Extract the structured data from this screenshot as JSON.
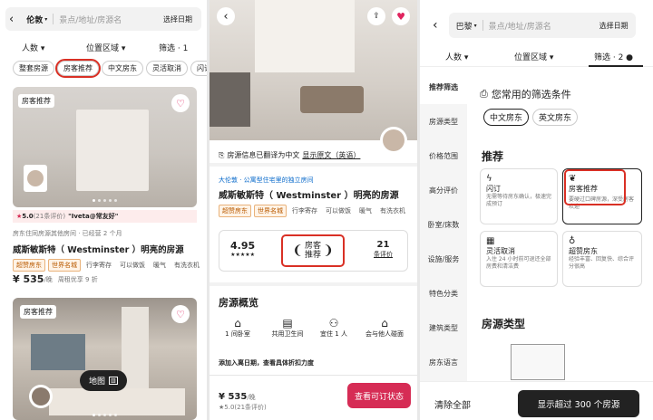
{
  "p1": {
    "city": "伦敦",
    "search_placeholder": "景点/地址/房源名",
    "date_btn": "选择日期",
    "filters": [
      {
        "label": "人数"
      },
      {
        "label": "位置区域"
      },
      {
        "label": "筛选 · 1"
      }
    ],
    "chips": [
      "整套房源",
      "房客推荐",
      "中文房东",
      "灵活取消",
      "闪订"
    ],
    "card1": {
      "badge": "房客推荐",
      "rating": "5.0",
      "rating_count": "(21条评价)",
      "quote": "\"Iveta@常友好\"",
      "host_line": "房东住同房源其他房间 · 已经营 2 个月",
      "title": "威斯敏斯特（ Westminster ）明亮的房源",
      "tags": [
        "超赞房东",
        "世界名城",
        "行李寄存",
        "可以做饭",
        "暖气",
        "有洗衣机"
      ],
      "price": "¥ 535",
      "price_unit": "/晚",
      "price_note": "周租优享 9 折"
    },
    "card2": {
      "badge": "房客推荐",
      "map_btn": "地图"
    }
  },
  "p2": {
    "translate_note": "房源信息已翻译为中文",
    "show_original": "显示原文（英语）",
    "location": "大伦敦 · 公寓型住宅里的独立房间",
    "title": "威斯敏斯特（ Westminster ）明亮的房源",
    "tags": [
      "超赞房东",
      "世界名城",
      "行李寄存",
      "可以做饭",
      "暖气",
      "有洗衣机"
    ],
    "rating": "4.95",
    "stars": "★★★★★",
    "award": "房客\n推荐",
    "reviews": "21",
    "reviews_label": "条评价",
    "overview_title": "房源概览",
    "amenities": [
      "1 间卧室",
      "共用卫生间",
      "宜住 1 人",
      "会与他人碰面"
    ],
    "date_hint": "添加入离日期，查看具体折扣力度",
    "price": "¥ 535",
    "price_unit": "/晚",
    "price_rating": "★5.0(21条评价)",
    "book_btn": "查看可订状态"
  },
  "p3": {
    "city": "巴黎",
    "search_placeholder": "景点/地址/房源名",
    "date_btn": "选择日期",
    "filters": [
      {
        "label": "人数"
      },
      {
        "label": "位置区域"
      },
      {
        "label": "筛选 · 2"
      }
    ],
    "sidebar": [
      "推荐筛选",
      "房源类型",
      "价格范围",
      "高分评价",
      "卧室/床数",
      "设施/服务",
      "特色分类",
      "建筑类型",
      "房东语言"
    ],
    "common_title": "您常用的筛选条件",
    "common_chips": [
      "中文房东",
      "英文房东"
    ],
    "rec_title": "推荐",
    "rec": [
      {
        "name": "闪订",
        "desc": "无需等待房东确认，极速完成预订",
        "icon": "lightning-icon"
      },
      {
        "name": "房客推荐",
        "desc": "要硬过口碑房源，深受房客欢迎",
        "icon": "laurel-icon"
      },
      {
        "name": "灵活取消",
        "desc": "入住 24 小时前可退还全部房费和清洁费",
        "icon": "calendar-icon"
      },
      {
        "name": "超赞房东",
        "desc": "经验丰富、回复快、综合评分很高",
        "icon": "medal-icon"
      }
    ],
    "type_title": "房源类型",
    "clear_btn": "清除全部",
    "show_btn": "显示超过 300 个房源"
  },
  "colors": {
    "accent": "#d62c55",
    "highlight": "#d93025",
    "orange": "#b85a00"
  }
}
